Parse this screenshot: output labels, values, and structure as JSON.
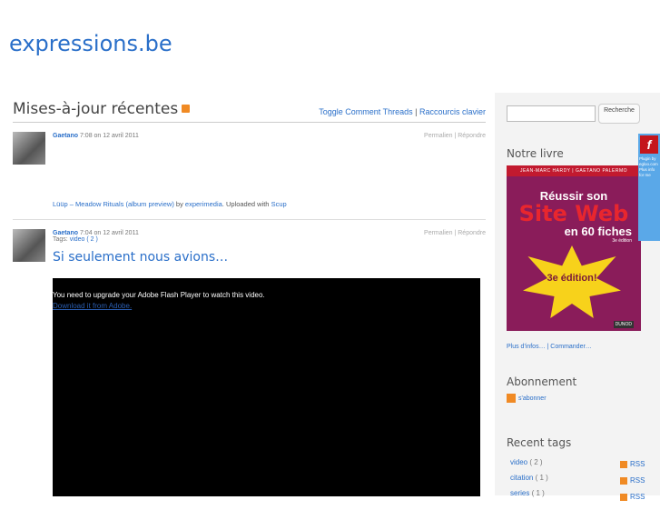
{
  "site": {
    "title": "expressions.be"
  },
  "main": {
    "heading": "Mises-à-jour récentes",
    "toggle_link": "Toggle Comment Threads",
    "separator": "|",
    "shortcuts_link": "Raccourcis clavier"
  },
  "posts": [
    {
      "author": "Gaetano",
      "time": "7:08 on 12 avril 2011",
      "actions": "Permalien | Répondre",
      "track": "Lüüp – Meadow Rituals (album preview)",
      "by": " by ",
      "artist": "experimedia",
      "uploaded": ". Uploaded with ",
      "app": "Scup"
    },
    {
      "author": "Gaetano",
      "time": "7:04 on 12 avril 2011",
      "tags_label": "Tags: ",
      "tag": "video",
      "tag_count": " ( 2 )",
      "actions": "Permalien | Répondre",
      "title": "Si seulement nous avions…",
      "video_message": "You need to upgrade your Adobe Flash Player to watch this video.",
      "video_link": "Download it from Adobe."
    }
  ],
  "sidebar": {
    "search_button": "Recherche",
    "book_heading": "Notre livre",
    "book": {
      "authors": "JEAN-MARC HARDY | GAETANO PALERMO",
      "line1": "Réussir son",
      "line2": "Site Web",
      "line3": "en 60 fiches",
      "edition_small": "3e édition",
      "star_text": "3e édition!",
      "publisher": "DUNOD"
    },
    "book_links": "Plus d'infos… | Commander…",
    "subscribe_heading": "Abonnement",
    "subscribe_link": "s'abonner",
    "tags_heading": "Recent tags",
    "tags": [
      {
        "name": "video",
        "count": " ( 2 )",
        "rss": "RSS"
      },
      {
        "name": "citation",
        "count": " ( 1 )",
        "rss": "RSS"
      },
      {
        "name": "series",
        "count": " ( 1 )",
        "rss": "RSS"
      }
    ]
  },
  "flash_widget": {
    "logo": "f",
    "text": "Plugin by egloo.com Plus info for me"
  }
}
